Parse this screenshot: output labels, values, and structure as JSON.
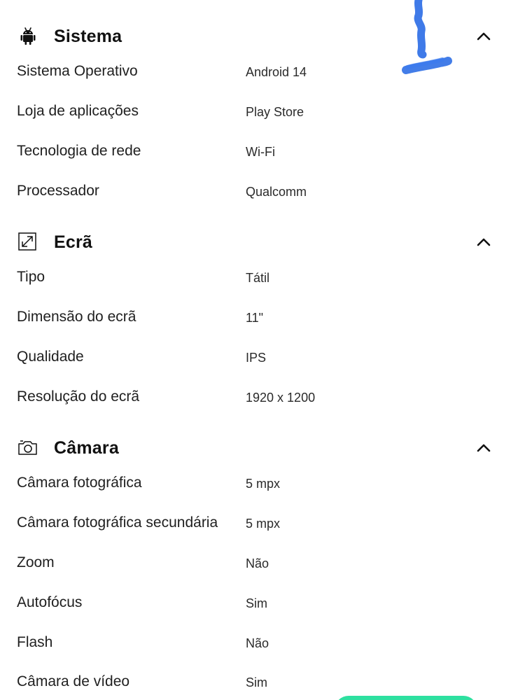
{
  "sections": [
    {
      "title": "Sistema",
      "icon": "android-icon",
      "expanded": true,
      "rows": [
        {
          "label": "Sistema Operativo",
          "value": "Android 14"
        },
        {
          "label": "Loja de aplicações",
          "value": "Play Store"
        },
        {
          "label": "Tecnologia de rede",
          "value": "Wi-Fi"
        },
        {
          "label": "Processador",
          "value": "Qualcomm"
        }
      ]
    },
    {
      "title": "Ecrã",
      "icon": "expand-screen-icon",
      "expanded": true,
      "rows": [
        {
          "label": "Tipo",
          "value": "Tátil"
        },
        {
          "label": "Dimensão do ecrã",
          "value": "11\""
        },
        {
          "label": "Qualidade",
          "value": "IPS"
        },
        {
          "label": "Resolução do ecrã",
          "value": "1920 x 1200"
        }
      ]
    },
    {
      "title": "Câmara",
      "icon": "camera-icon",
      "expanded": true,
      "rows": [
        {
          "label": "Câmara fotográfica",
          "value": "5 mpx"
        },
        {
          "label": "Câmara fotográfica secundária",
          "value": "5 mpx"
        },
        {
          "label": "Zoom",
          "value": "Não"
        },
        {
          "label": "Autofócus",
          "value": "Sim"
        },
        {
          "label": "Flash",
          "value": "Não"
        },
        {
          "label": "Câmara de vídeo",
          "value": "Sim"
        }
      ]
    }
  ],
  "chevron_icon": "chevron-up-icon",
  "colors": {
    "text": "#1f1f1f",
    "value_text": "#2a2a2a",
    "pen_annotation": "#2f6fe6",
    "floating_button": "#2ee0a0"
  }
}
